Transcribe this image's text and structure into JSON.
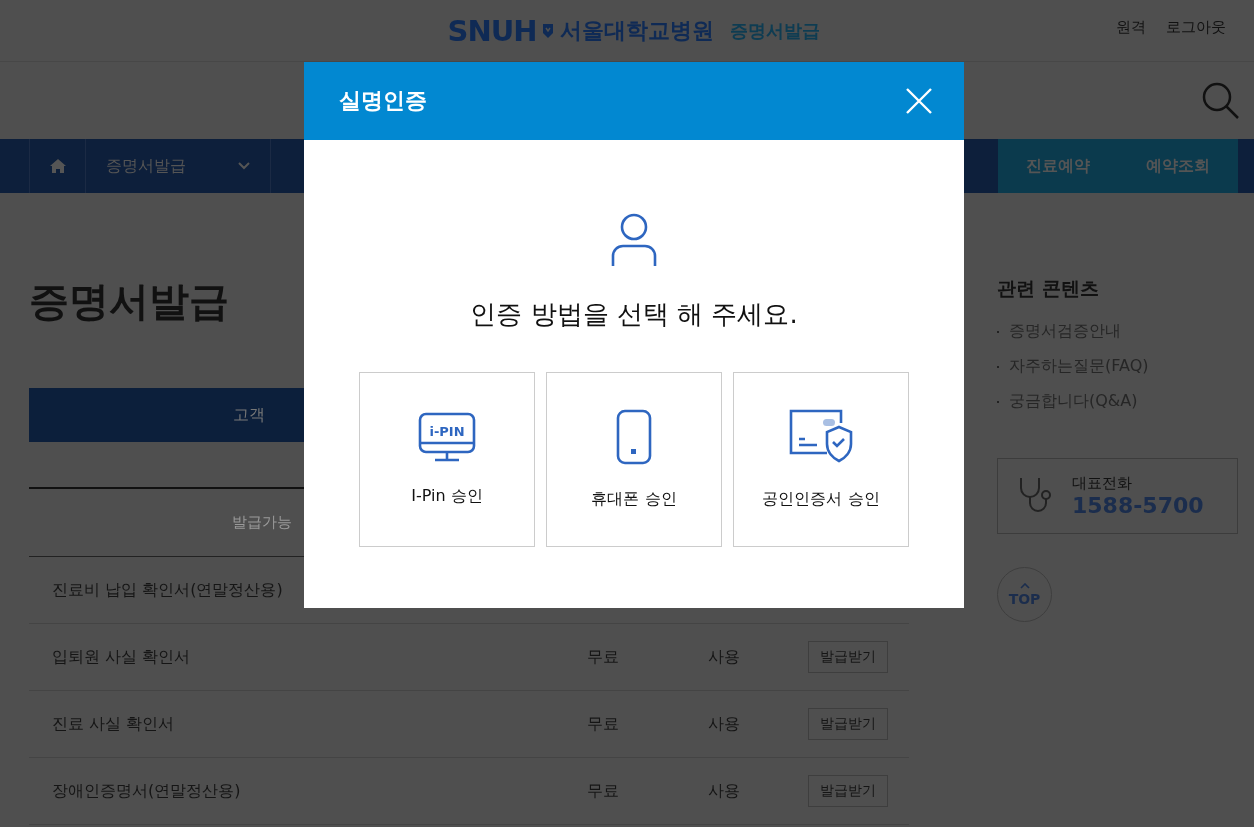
{
  "header": {
    "logo": "SNUH",
    "hospital": "서울대학교병원",
    "service": "증명서발급",
    "links": [
      "원격",
      "로그아웃"
    ]
  },
  "nav": {
    "items": [
      {
        "label": "증명서발급"
      }
    ],
    "right_buttons": [
      "진료예약",
      "예약조회"
    ]
  },
  "page_title": "증명서발급",
  "tabs": [
    {
      "label": "고객",
      "selected": true
    }
  ],
  "table": {
    "column_1": "발급가능",
    "rows": [
      {
        "name": "진료비 납입 확인서(연말정산용)"
      },
      {
        "name": "입퇴원 사실 확인서",
        "fee": "무료",
        "use": "사용",
        "action": "발급받기"
      },
      {
        "name": "진료 사실 확인서",
        "fee": "무료",
        "use": "사용",
        "action": "발급받기"
      },
      {
        "name": "장애인증명서(연말정산용)",
        "fee": "무료",
        "use": "사용",
        "action": "발급받기"
      }
    ]
  },
  "sidebar": {
    "title": "관련 콘텐츠",
    "links": [
      "증명서검증안내",
      "자주하는질문(FAQ)",
      "궁금합니다(Q&A)"
    ],
    "phone_label": "대표전화",
    "phone": "1588-5700",
    "top": "TOP"
  },
  "modal": {
    "title": "실명인증",
    "prompt": "인증 방법을 선택 해 주세요.",
    "options": [
      {
        "kind": "ipin",
        "badge": "i-PIN",
        "label": "I-Pin 승인"
      },
      {
        "kind": "phone",
        "label": "휴대폰 승인"
      },
      {
        "kind": "cert",
        "label": "공인인증서 승인"
      }
    ]
  }
}
